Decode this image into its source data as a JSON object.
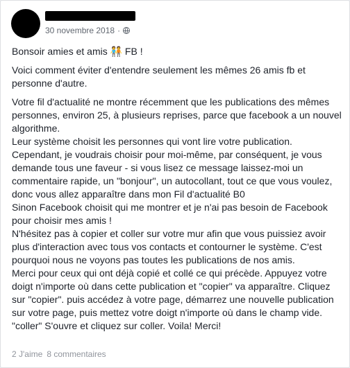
{
  "post": {
    "date": "30 novembre 2018",
    "separator": "·",
    "greeting": "Bonsoir amies et amis 🧑‍🤝‍🧑 FB !",
    "paragraph_1": "Voici comment éviter d'entendre seulement les mêmes 26 amis fb et personne d'autre.",
    "paragraph_2": "Votre fil d'actualité ne montre récemment que les publications des mêmes personnes, environ 25, à plusieurs reprises, parce que facebook a un nouvel algorithme.\nLeur système choisit les personnes qui vont lire votre publication. Cependant, je voudrais choisir pour moi-même, par conséquent, je vous demande tous une faveur - si vous lisez ce message laissez-moi un commentaire rapide, un \"bonjour\", un autocollant, tout ce que vous voulez, donc vous allez apparaître dans mon Fil d'actualité B0\nSinon Facebook choisit qui me montrer et je n'ai pas besoin de Facebook pour choisir mes amis !\nN'hésitez pas à copier et coller sur votre mur afin que vous puissiez avoir plus d'interaction avec tous vos contacts et contourner le système. C'est pourquoi nous ne voyons pas toutes les publications de nos amis.\nMerci pour ceux qui ont déjà copié et collé ce qui précède. Appuyez votre doigt n'importe où dans cette publication et \"copier\" va apparaître. Cliquez sur \"copier\". puis accédez à votre page, démarrez une nouvelle publication sur votre page, puis mettez votre doigt n'importe où dans le champ vide. \"coller\" S'ouvre et cliquez sur coller. Voila! Merci!"
  },
  "footer": {
    "likes": "2 J'aime",
    "comments": "8 commentaires"
  },
  "icons": {
    "privacy": "globe-icon",
    "emoji": "people-holding-hands"
  }
}
